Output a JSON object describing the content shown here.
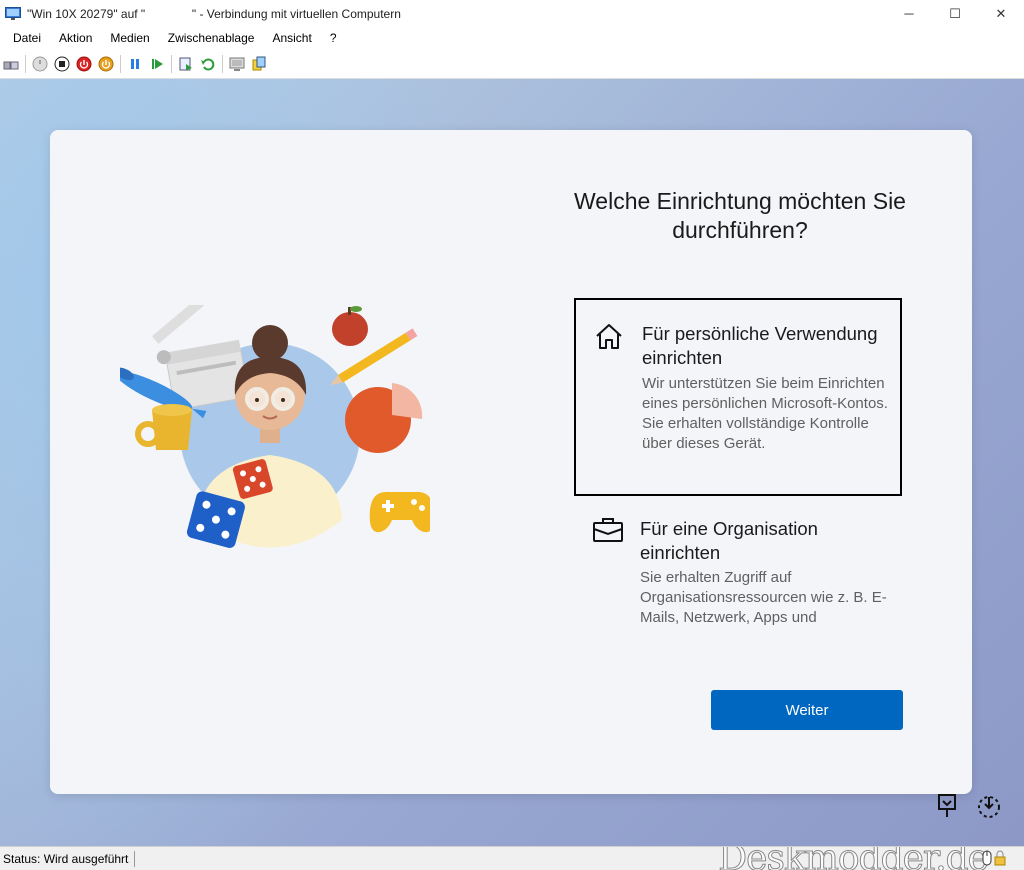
{
  "window": {
    "title": "\"Win 10X 20279\" auf \"              \" - Verbindung mit virtuellen Computern",
    "minimize": "─",
    "maximize": "☐",
    "close": "✕"
  },
  "menu": [
    "Datei",
    "Aktion",
    "Medien",
    "Zwischenablage",
    "Ansicht",
    "?"
  ],
  "toolbar_icons": [
    "ctrl-alt-del-icon",
    "start-icon",
    "turn-off-icon",
    "shutdown-icon",
    "save-icon",
    "pause-icon",
    "resume-icon",
    "checkpoint-icon",
    "revert-icon",
    "enhanced-session-icon",
    "share-icon"
  ],
  "oobe": {
    "question": "Welche Einrichtung möchten Sie durchführen?",
    "options": [
      {
        "title": "Für persönliche Verwendung einrichten",
        "description": "Wir unterstützen Sie beim Einrichten eines persönlichen Microsoft-Kontos. Sie erhalten vollständige Kontrolle über dieses Gerät.",
        "icon": "home-icon",
        "selected": true
      },
      {
        "title": "Für eine Organisation einrichten",
        "description": "Sie erhalten Zugriff auf Organisationsressourcen wie z. B. E-Mails, Netzwerk, Apps und",
        "icon": "briefcase-icon",
        "selected": false
      }
    ],
    "next_label": "Weiter"
  },
  "status": {
    "text": "Status: Wird ausgeführt",
    "watermark": "Deskmodder.de"
  },
  "colors": {
    "accent": "#0067c0",
    "card": "#f3f5f9"
  }
}
